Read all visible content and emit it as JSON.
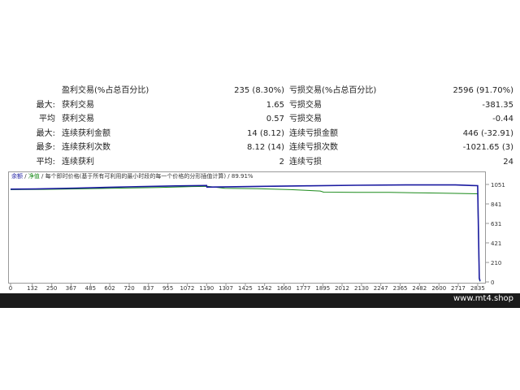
{
  "stats_rows": [
    {
      "prefix": "",
      "label1": "盈利交易(%占总百分比)",
      "value1": "235 (8.30%)",
      "label2": "亏损交易(%占总百分比)",
      "value2": "2596 (91.70%)"
    },
    {
      "prefix": "最大:",
      "label1": "获利交易",
      "value1": "1.65",
      "label2": "亏损交易",
      "value2": "-381.35"
    },
    {
      "prefix": "平均",
      "label1": "获利交易",
      "value1": "0.57",
      "label2": "亏损交易",
      "value2": "-0.44"
    },
    {
      "prefix": "最大:",
      "label1": "连续获利金额",
      "value1": "14 (8.12)",
      "label2": "连续亏损金额",
      "value2": "446 (-32.91)"
    },
    {
      "prefix": "最多:",
      "label1": "连续获利次数",
      "value1": "8.12 (14)",
      "label2": "连续亏损次数",
      "value2": "-1021.65 (3)"
    },
    {
      "prefix": "平均:",
      "label1": "连续获利",
      "value1": "2",
      "label2": "连续亏损",
      "value2": "24"
    }
  ],
  "chart": {
    "legend_balance": "余额",
    "legend_sep": " / ",
    "legend_equity": "净值",
    "legend_rest": " / 每个即时价格(基于所有可利用的最小时段的每一个价格的分形插值计算) / 89.91%",
    "colors": {
      "balance": "#1a1aa0",
      "equity": "#1a8a1a",
      "grid": "#9a9a9a"
    }
  },
  "chart_data": {
    "type": "line",
    "x_ticks": [
      "0",
      "132",
      "250",
      "367",
      "485",
      "602",
      "720",
      "837",
      "955",
      "1072",
      "1190",
      "1307",
      "1425",
      "1542",
      "1660",
      "1777",
      "1895",
      "2012",
      "2130",
      "2247",
      "2365",
      "2482",
      "2600",
      "2717",
      "2835"
    ],
    "y_ticks": [
      "1051",
      "841",
      "631",
      "421",
      "210",
      "0"
    ],
    "ylim": [
      0,
      1051
    ],
    "xlim": [
      0,
      2870
    ],
    "series": [
      {
        "name": "余额",
        "points": [
          [
            0,
            1000
          ],
          [
            150,
            1002
          ],
          [
            400,
            1012
          ],
          [
            700,
            1025
          ],
          [
            1000,
            1035
          ],
          [
            1190,
            1040
          ],
          [
            1192,
            1022
          ],
          [
            1500,
            1030
          ],
          [
            1800,
            1036
          ],
          [
            2100,
            1042
          ],
          [
            2400,
            1046
          ],
          [
            2700,
            1046
          ],
          [
            2800,
            1040
          ],
          [
            2835,
            1038
          ],
          [
            2845,
            40
          ],
          [
            2850,
            10
          ]
        ]
      },
      {
        "name": "净值",
        "points": [
          [
            0,
            995
          ],
          [
            200,
            998
          ],
          [
            400,
            1003
          ],
          [
            600,
            1010
          ],
          [
            900,
            1018
          ],
          [
            1100,
            1028
          ],
          [
            1200,
            1030
          ],
          [
            1300,
            1010
          ],
          [
            1500,
            1005
          ],
          [
            1700,
            995
          ],
          [
            1880,
            980
          ],
          [
            1900,
            968
          ],
          [
            2100,
            966
          ],
          [
            2300,
            965
          ],
          [
            2500,
            960
          ],
          [
            2700,
            955
          ],
          [
            2835,
            950
          ],
          [
            2845,
            30
          ],
          [
            2850,
            5
          ]
        ]
      }
    ]
  },
  "footer": {
    "site": "www.mt4.shop"
  }
}
